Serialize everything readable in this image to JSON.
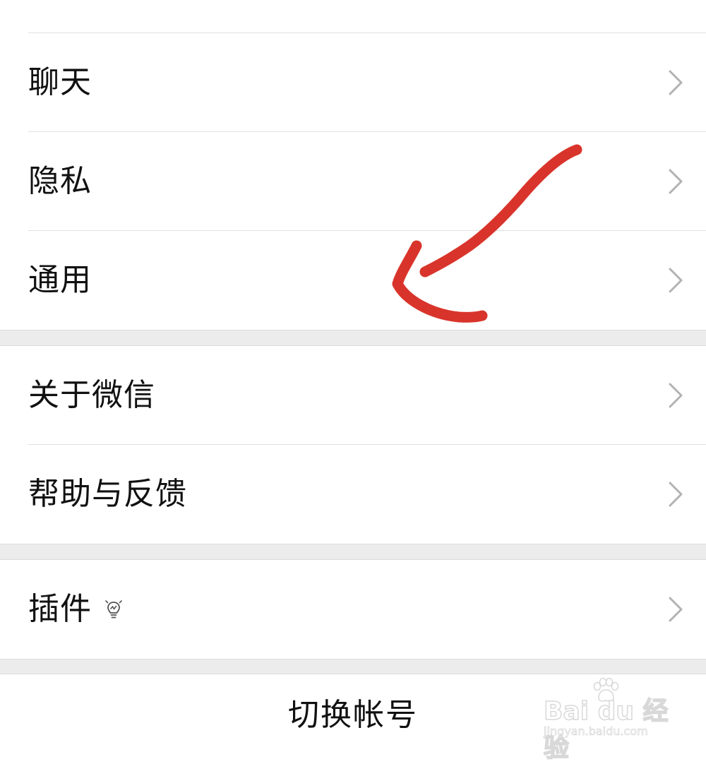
{
  "settings": {
    "group1": [
      {
        "label": "聊天",
        "icon": "chevron-right-icon"
      },
      {
        "label": "隐私",
        "icon": "chevron-right-icon"
      },
      {
        "label": "通用",
        "icon": "chevron-right-icon"
      }
    ],
    "group2": [
      {
        "label": "关于微信",
        "icon": "chevron-right-icon"
      },
      {
        "label": "帮助与反馈",
        "icon": "chevron-right-icon"
      }
    ],
    "group3": [
      {
        "label": "插件",
        "badge_icon": "lightbulb-icon",
        "icon": "chevron-right-icon"
      }
    ],
    "switch_account": "切换帐号"
  },
  "annotation": {
    "type": "hand-drawn-arrow",
    "color": "#d9342b"
  },
  "watermark": {
    "brand": "Bai du 经验",
    "site": "jingyan.baidu.com"
  },
  "colors": {
    "background": "#ffffff",
    "group_gap": "#ececec",
    "divider": "#e0e0e0",
    "chevron": "#b2b2b2",
    "text": "#111111"
  }
}
